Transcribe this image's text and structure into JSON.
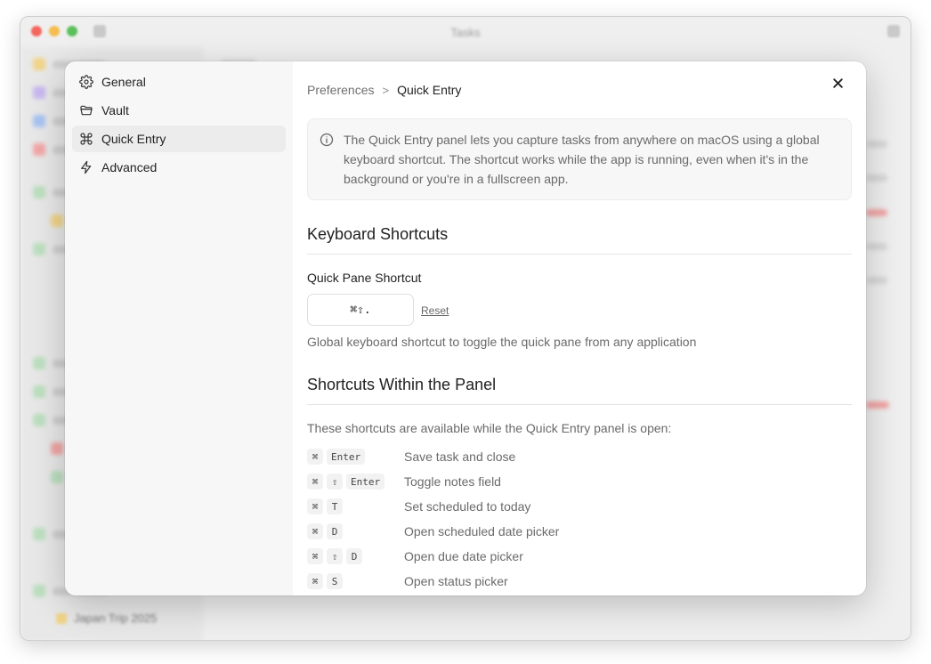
{
  "window": {
    "title": "Tasks",
    "bottom_item": "Japan Trip 2025"
  },
  "sidebar": {
    "items": [
      {
        "label": "General",
        "icon": "gear-icon"
      },
      {
        "label": "Vault",
        "icon": "folder-icon"
      },
      {
        "label": "Quick Entry",
        "icon": "command-icon",
        "active": true
      },
      {
        "label": "Advanced",
        "icon": "lightning-icon"
      }
    ]
  },
  "breadcrumb": {
    "root": "Preferences",
    "separator": ">",
    "current": "Quick Entry"
  },
  "info": {
    "icon": "info-icon",
    "text": "The Quick Entry panel lets you capture tasks from anywhere on macOS using a global keyboard shortcut. The shortcut works while the app is running, even when it's in the background or you're in a fullscreen app."
  },
  "keyboard_shortcuts": {
    "title": "Keyboard Shortcuts",
    "quick_pane": {
      "label": "Quick Pane Shortcut",
      "value": "⌘⇧.",
      "reset_label": "Reset",
      "help": "Global keyboard shortcut to toggle the quick pane from any application"
    }
  },
  "panel_shortcuts": {
    "title": "Shortcuts Within the Panel",
    "intro": "These shortcuts are available while the Quick Entry panel is open:",
    "rows": [
      {
        "keys": [
          "⌘",
          "Enter"
        ],
        "desc": "Save task and close"
      },
      {
        "keys": [
          "⌘",
          "⇧",
          "Enter"
        ],
        "desc": "Toggle notes field"
      },
      {
        "keys": [
          "⌘",
          "T"
        ],
        "desc": "Set scheduled to today"
      },
      {
        "keys": [
          "⌘",
          "D"
        ],
        "desc": "Open scheduled date picker"
      },
      {
        "keys": [
          "⌘",
          "⇧",
          "D"
        ],
        "desc": "Open due date picker"
      },
      {
        "keys": [
          "⌘",
          "S"
        ],
        "desc": "Open status picker"
      }
    ]
  },
  "colors": {
    "modal_bg": "#ffffff",
    "sidebar_bg": "#f7f7f7",
    "active_item": "#ececec",
    "muted_text": "#6a6a6a"
  }
}
